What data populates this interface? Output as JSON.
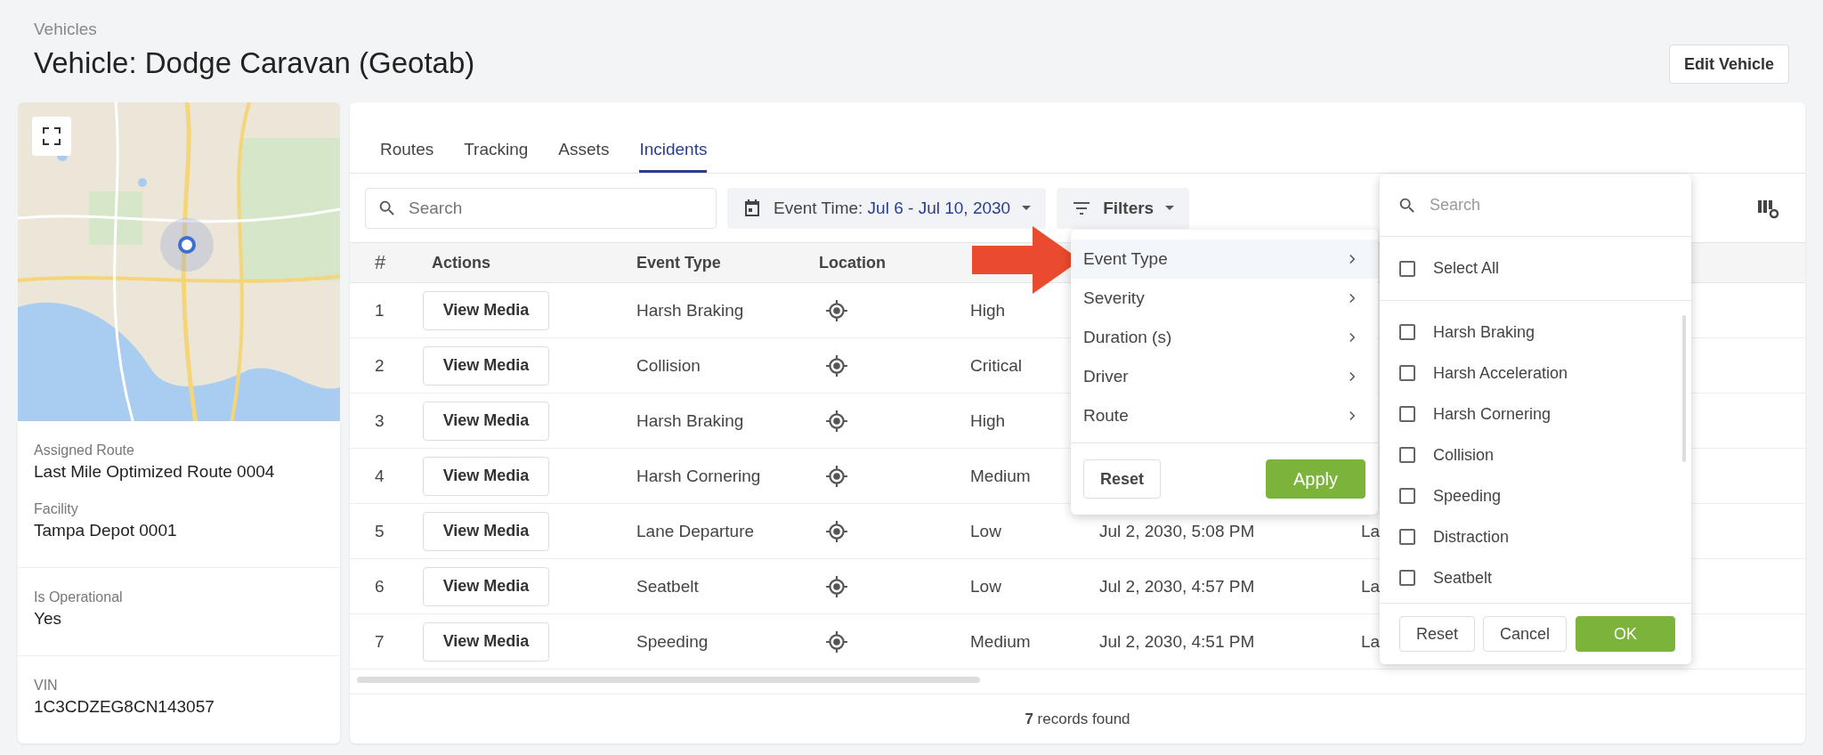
{
  "breadcrumb": "Vehicles",
  "title": "Vehicle: Dodge Caravan (Geotab)",
  "edit_button": "Edit Vehicle",
  "details": [
    [
      {
        "label": "Assigned Route",
        "value": "Last Mile Optimized Route 0004"
      },
      {
        "label": "Facility",
        "value": "Tampa Depot 0001"
      }
    ],
    [
      {
        "label": "Is Operational",
        "value": "Yes"
      }
    ],
    [
      {
        "label": "VIN",
        "value": "1C3CDZEG8CN143057"
      }
    ]
  ],
  "tabs": [
    {
      "label": "Routes",
      "selected": false
    },
    {
      "label": "Tracking",
      "selected": false
    },
    {
      "label": "Assets",
      "selected": false
    },
    {
      "label": "Incidents",
      "selected": true
    }
  ],
  "search": {
    "placeholder": "Search"
  },
  "event_time": {
    "label": "Event Time:",
    "value": "Jul 6 - Jul 10, 2030"
  },
  "filters_button": "Filters",
  "table": {
    "columns": [
      "#",
      "Actions",
      "Event Type",
      "Location"
    ],
    "rows": [
      {
        "number": "1",
        "action": "View Media",
        "event_type": "Harsh Braking",
        "severity": "High"
      },
      {
        "number": "2",
        "action": "View Media",
        "event_type": "Collision",
        "severity": "Critical"
      },
      {
        "number": "3",
        "action": "View Media",
        "event_type": "Harsh Braking",
        "severity": "High"
      },
      {
        "number": "4",
        "action": "View Media",
        "event_type": "Harsh Cornering",
        "severity": "Medium"
      },
      {
        "number": "5",
        "action": "View Media",
        "event_type": "Lane Departure",
        "severity": "Low",
        "datetime": "Jul 2, 2030, 5:08 PM",
        "column_7": "La"
      },
      {
        "number": "6",
        "action": "View Media",
        "event_type": "Seatbelt",
        "severity": "Low",
        "datetime": "Jul 2, 2030, 4:57 PM",
        "column_7": "La"
      },
      {
        "number": "7",
        "action": "View Media",
        "event_type": "Speeding",
        "severity": "Medium",
        "datetime": "Jul 2, 2030, 4:51 PM",
        "column_7": "La"
      }
    ]
  },
  "records": "**7** records found",
  "filter_menu": {
    "items": [
      {
        "label": "Event Type",
        "selected": true
      },
      {
        "label": "Severity",
        "selected": false
      },
      {
        "label": "Duration (s)",
        "selected": false
      },
      {
        "label": "Driver",
        "selected": false
      },
      {
        "label": "Route",
        "selected": false
      }
    ],
    "buttons": [
      {
        "label": "Reset",
        "kind": "default"
      },
      {
        "label": "Apply",
        "kind": "primary"
      }
    ]
  },
  "event_type_menu": {
    "search_placeholder": "Search",
    "select_all": {
      "label": "Select All",
      "checked": false
    },
    "options": [
      {
        "label": "Harsh Braking",
        "checked": false
      },
      {
        "label": "Harsh Acceleration",
        "checked": false
      },
      {
        "label": "Harsh Cornering",
        "checked": false
      },
      {
        "label": "Collision",
        "checked": false
      },
      {
        "label": "Speeding",
        "checked": false
      },
      {
        "label": "Distraction",
        "checked": false
      },
      {
        "label": "Seatbelt",
        "checked": false
      }
    ],
    "buttons": [
      {
        "label": "Reset",
        "kind": "default"
      },
      {
        "label": "Cancel",
        "kind": "default"
      },
      {
        "label": "OK",
        "kind": "primary"
      }
    ]
  }
}
